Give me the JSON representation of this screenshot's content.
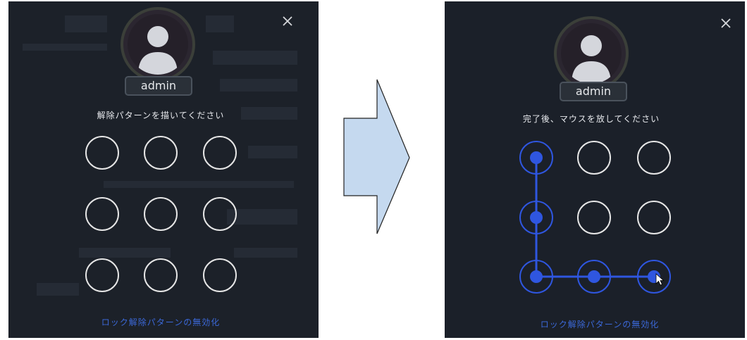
{
  "before": {
    "username": "admin",
    "instruction": "解除パターンを描いてください",
    "disable_link": "ロック解除パターンの無効化",
    "pattern_selected": []
  },
  "after": {
    "username": "admin",
    "instruction": "完了後、マウスを放してください",
    "disable_link": "ロック解除パターンの無効化",
    "pattern_selected": [
      1,
      4,
      7,
      8,
      9
    ]
  },
  "icons": {
    "close": "close-icon",
    "avatar": "user-avatar-icon",
    "cursor": "mouse-pointer-icon",
    "arrow": "right-arrow-icon"
  },
  "colors": {
    "panel_bg": "#1c2129",
    "node_idle": "#e6e6e6",
    "node_active": "#2f56e0",
    "link_text": "#3b68d8",
    "arrow_fill": "#c5d9ef"
  }
}
